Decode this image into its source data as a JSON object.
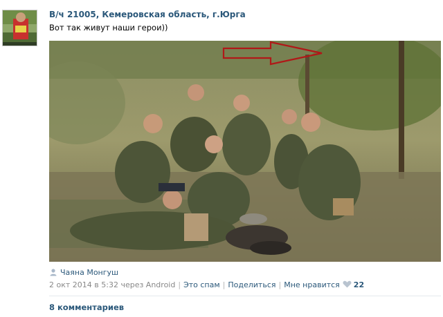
{
  "post": {
    "group_name": "В/ч 21005, Кемеровская область, г.Юрга",
    "text": "Вот так живут наши герои))",
    "author": "Чаяна Монгуш",
    "date": "2 окт 2014 в 5:32 через Android",
    "actions": {
      "spam": "Это спам",
      "share": "Поделиться",
      "like": "Мне нравится"
    },
    "likes_count": "22",
    "comments_label": "8 комментариев"
  },
  "colors": {
    "link": "#2b587a",
    "meta": "#888888",
    "heart": "#b9c4d0",
    "arrow": "#b01818"
  },
  "icons": {
    "author": "user-icon",
    "like": "heart-icon",
    "photo_annotation": "arrow-icon"
  }
}
